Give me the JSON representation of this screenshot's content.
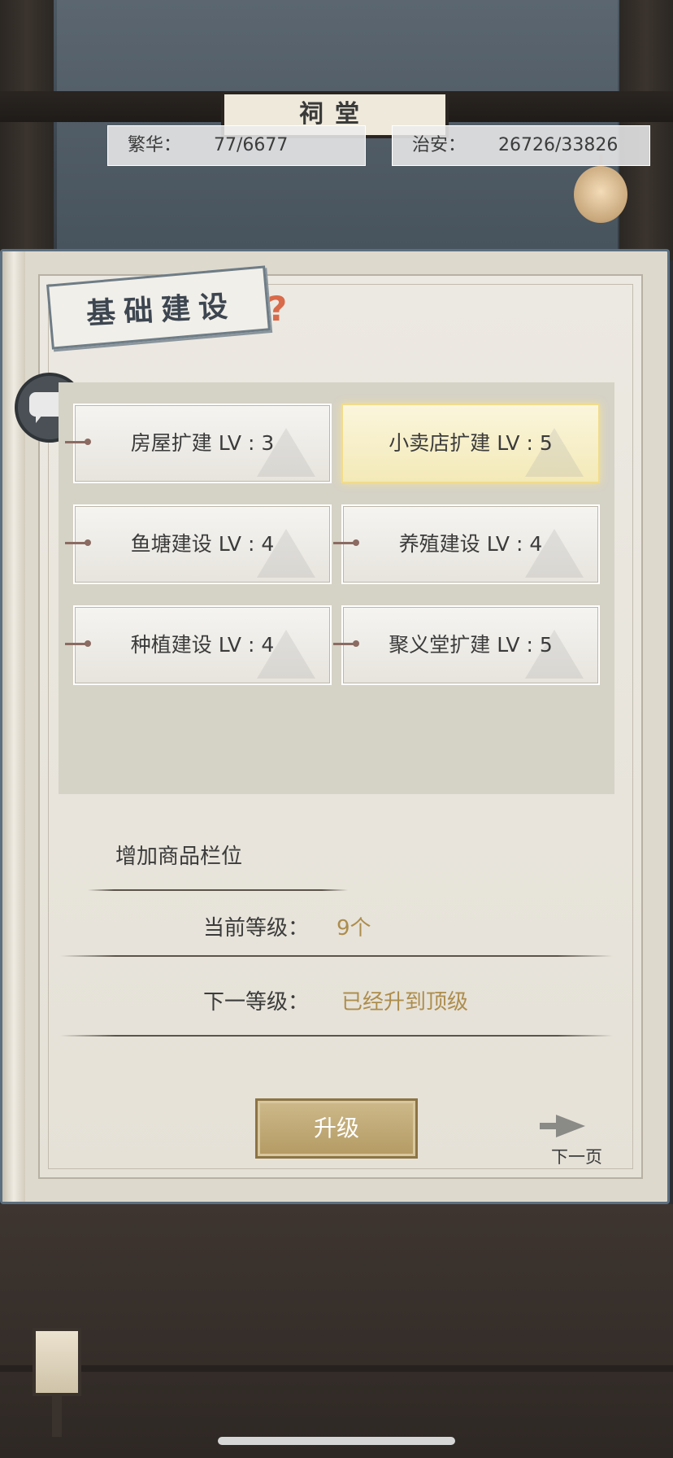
{
  "header": {
    "plaque_text": "祠堂",
    "prosperity": {
      "label": "繁华：",
      "value": "77/6677"
    },
    "security": {
      "label": "治安：",
      "value": "26726/33826"
    }
  },
  "panel": {
    "title": "基础建设",
    "help_glyph": "?",
    "chat_glyph": "..."
  },
  "buildings": [
    {
      "label": "房屋扩建 LV : 3",
      "selected": false
    },
    {
      "label": "小卖店扩建 LV : 5",
      "selected": true
    },
    {
      "label": "鱼塘建设 LV : 4",
      "selected": false
    },
    {
      "label": "养殖建设 LV : 4",
      "selected": false
    },
    {
      "label": "种植建设 LV : 4",
      "selected": false
    },
    {
      "label": "聚义堂扩建 LV : 5",
      "selected": false
    }
  ],
  "detail": {
    "heading": "增加商品栏位",
    "current_label": "当前等级：",
    "current_value": "9个",
    "next_label": "下一等级：",
    "next_value": "已经升到顶级"
  },
  "actions": {
    "upgrade_label": "升级",
    "next_page_label": "下一页"
  },
  "colors": {
    "panel_border": "#5b6f80",
    "selected_card": "#f3e9b8",
    "value_text": "#ad8d4d",
    "upgrade_button": "#b49a63"
  }
}
